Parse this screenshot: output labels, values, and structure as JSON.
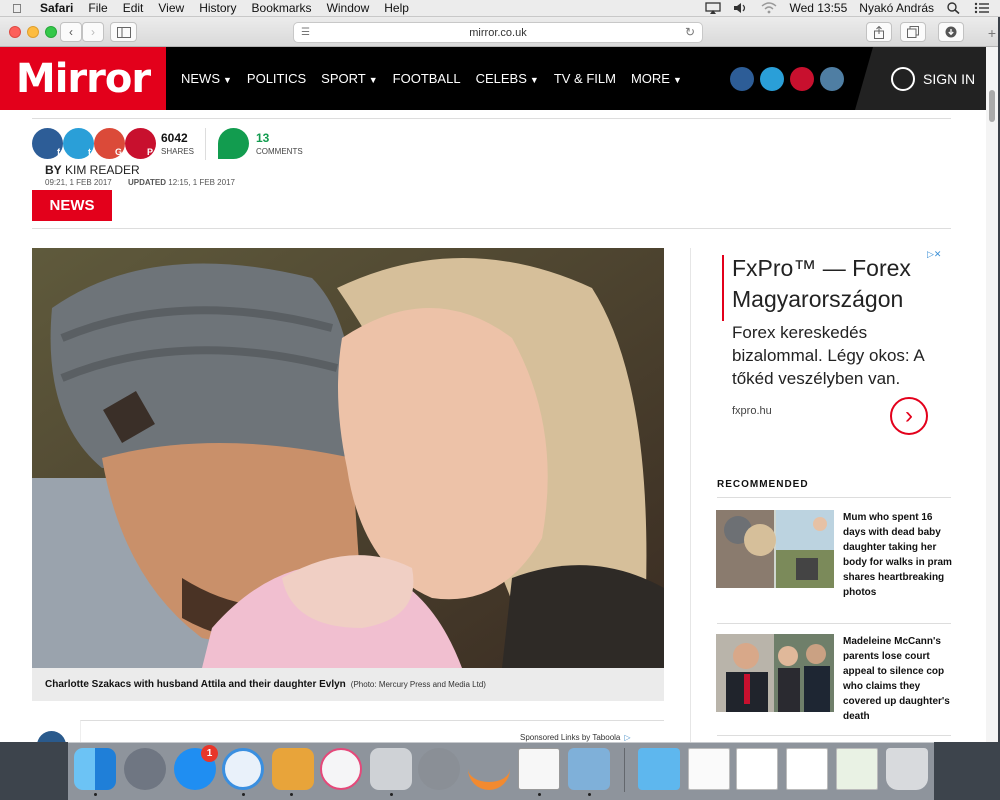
{
  "menubar": {
    "app": "Safari",
    "items": [
      "File",
      "Edit",
      "View",
      "History",
      "Bookmarks",
      "Window",
      "Help"
    ],
    "clock": "Wed 13:55",
    "user": "Nyakó András"
  },
  "browser": {
    "url": "mirror.co.uk"
  },
  "site": {
    "logo": "Mirror",
    "nav": [
      "NEWS",
      "POLITICS",
      "SPORT",
      "FOOTBALL",
      "CELEBS",
      "TV & FILM",
      "MORE"
    ],
    "signin": "SIGN IN"
  },
  "article": {
    "shares_count": "6042",
    "shares_label": "SHARES",
    "comments_count": "13",
    "comments_label": "COMMENTS",
    "by": "BY",
    "author": "KIM READER",
    "published": "09:21, 1 FEB 2017",
    "updated_label": "UPDATED",
    "updated": "12:15, 1 FEB 2017",
    "tag": "NEWS",
    "caption": "Charlotte Szakacs with husband Attila and their daughter Evlyn",
    "credit": "(Photo: Mercury Press and Media Ltd)",
    "sponsored": "Sponsored Links by Taboola"
  },
  "ad": {
    "title": "FxPro™ — Forex Magyarországon",
    "body": "Forex kereskedés bizalommal. Légy okos: A tőkéd veszélyben van.",
    "domain": "fxpro.hu"
  },
  "recommended": {
    "heading": "RECOMMENDED",
    "items": [
      {
        "text": "Mum who spent 16 days with dead baby daughter taking her body for walks in pram shares heartbreaking photos"
      },
      {
        "text": "Madeleine McCann's parents lose court appeal to silence cop who claims they covered up daughter's death"
      }
    ]
  },
  "dock": {
    "appstore_badge": "1"
  },
  "colors": {
    "mirror_red": "#e3001b",
    "nav_black": "#000000",
    "comment_green": "#129c4f"
  }
}
